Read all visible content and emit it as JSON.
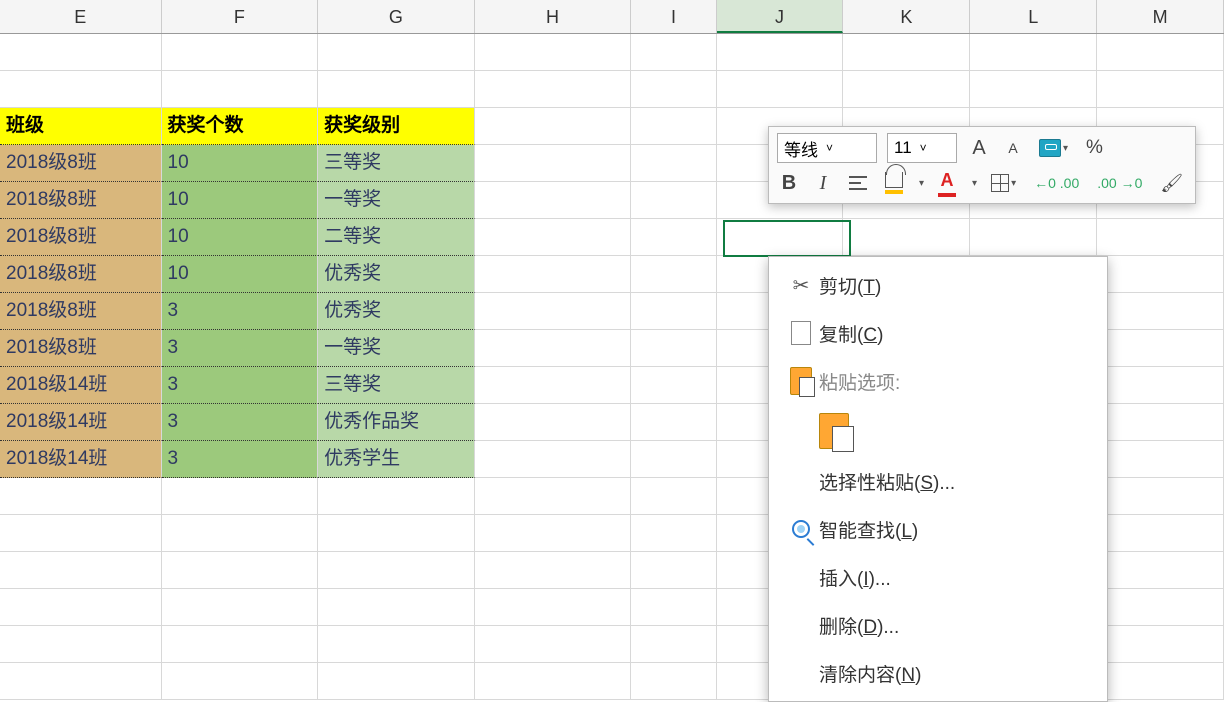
{
  "columns": [
    "E",
    "F",
    "G",
    "H",
    "I",
    "J",
    "K",
    "L",
    "M"
  ],
  "selected_column": "J",
  "selected_cell": {
    "col": "J",
    "row": 6
  },
  "table": {
    "headers": {
      "class": "班级",
      "count": "获奖个数",
      "level": "获奖级别"
    },
    "rows": [
      {
        "class": "2018级8班",
        "count": "10",
        "level": "三等奖"
      },
      {
        "class": "2018级8班",
        "count": "10",
        "level": "一等奖"
      },
      {
        "class": "2018级8班",
        "count": "10",
        "level": "二等奖"
      },
      {
        "class": "2018级8班",
        "count": "10",
        "level": "优秀奖"
      },
      {
        "class": "2018级8班",
        "count": "3",
        "level": "优秀奖"
      },
      {
        "class": "2018级8班",
        "count": "3",
        "level": "一等奖"
      },
      {
        "class": "2018级14班",
        "count": "3",
        "level": "三等奖"
      },
      {
        "class": "2018级14班",
        "count": "3",
        "level": "优秀作品奖"
      },
      {
        "class": "2018级14班",
        "count": "3",
        "level": "优秀学生"
      }
    ]
  },
  "mini_toolbar": {
    "font_name": "等线",
    "font_size": "11",
    "bold": "B",
    "italic": "I",
    "percent": "%",
    "font_color_letter": "A",
    "inc_dec_1": "←0  .00",
    "inc_dec_2": ".00  →0"
  },
  "context_menu": {
    "cut": "剪切(",
    "cut_key": "T",
    "cut_close": ")",
    "copy": "复制(",
    "copy_key": "C",
    "copy_close": ")",
    "paste_options": "粘贴选项:",
    "paste_special": "选择性粘贴(",
    "paste_special_key": "S",
    "paste_special_close": ")...",
    "smart_lookup": "智能查找(",
    "smart_lookup_key": "L",
    "smart_lookup_close": ")",
    "insert": "插入(",
    "insert_key": "I",
    "insert_close": ")...",
    "delete": "删除(",
    "delete_key": "D",
    "delete_close": ")...",
    "clear": "清除内容(",
    "clear_key": "N",
    "clear_close": ")"
  }
}
